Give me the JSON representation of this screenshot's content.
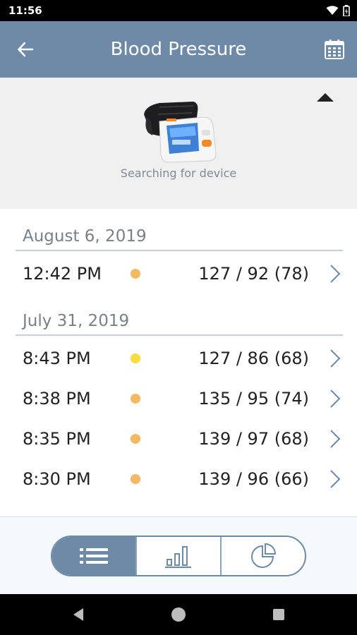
{
  "status_bar": {
    "time": "11:56"
  },
  "app_bar": {
    "title": "Blood Pressure"
  },
  "device": {
    "status": "Searching for device"
  },
  "groups": [
    {
      "date": "August 6, 2019",
      "readings": [
        {
          "time": "12:42 PM",
          "value": "127 / 92 (78)",
          "dot_color": "#f5b964"
        }
      ]
    },
    {
      "date": "July 31, 2019",
      "readings": [
        {
          "time": "8:43 PM",
          "value": "127 / 86 (68)",
          "dot_color": "#f7de3e"
        },
        {
          "time": "8:38 PM",
          "value": "135 / 95 (74)",
          "dot_color": "#f5b964"
        },
        {
          "time": "8:35 PM",
          "value": "139 / 97 (68)",
          "dot_color": "#f5b964"
        },
        {
          "time": "8:30 PM",
          "value": "139 / 96 (66)",
          "dot_color": "#f5b964"
        }
      ]
    }
  ],
  "view_toggle": {
    "options": [
      "list-icon",
      "bar-chart-icon",
      "pie-chart-icon"
    ],
    "active": "list-icon"
  },
  "colors": {
    "header": "#6e8aa6",
    "dot_orange": "#f5b964",
    "dot_yellow": "#f7de3e"
  }
}
